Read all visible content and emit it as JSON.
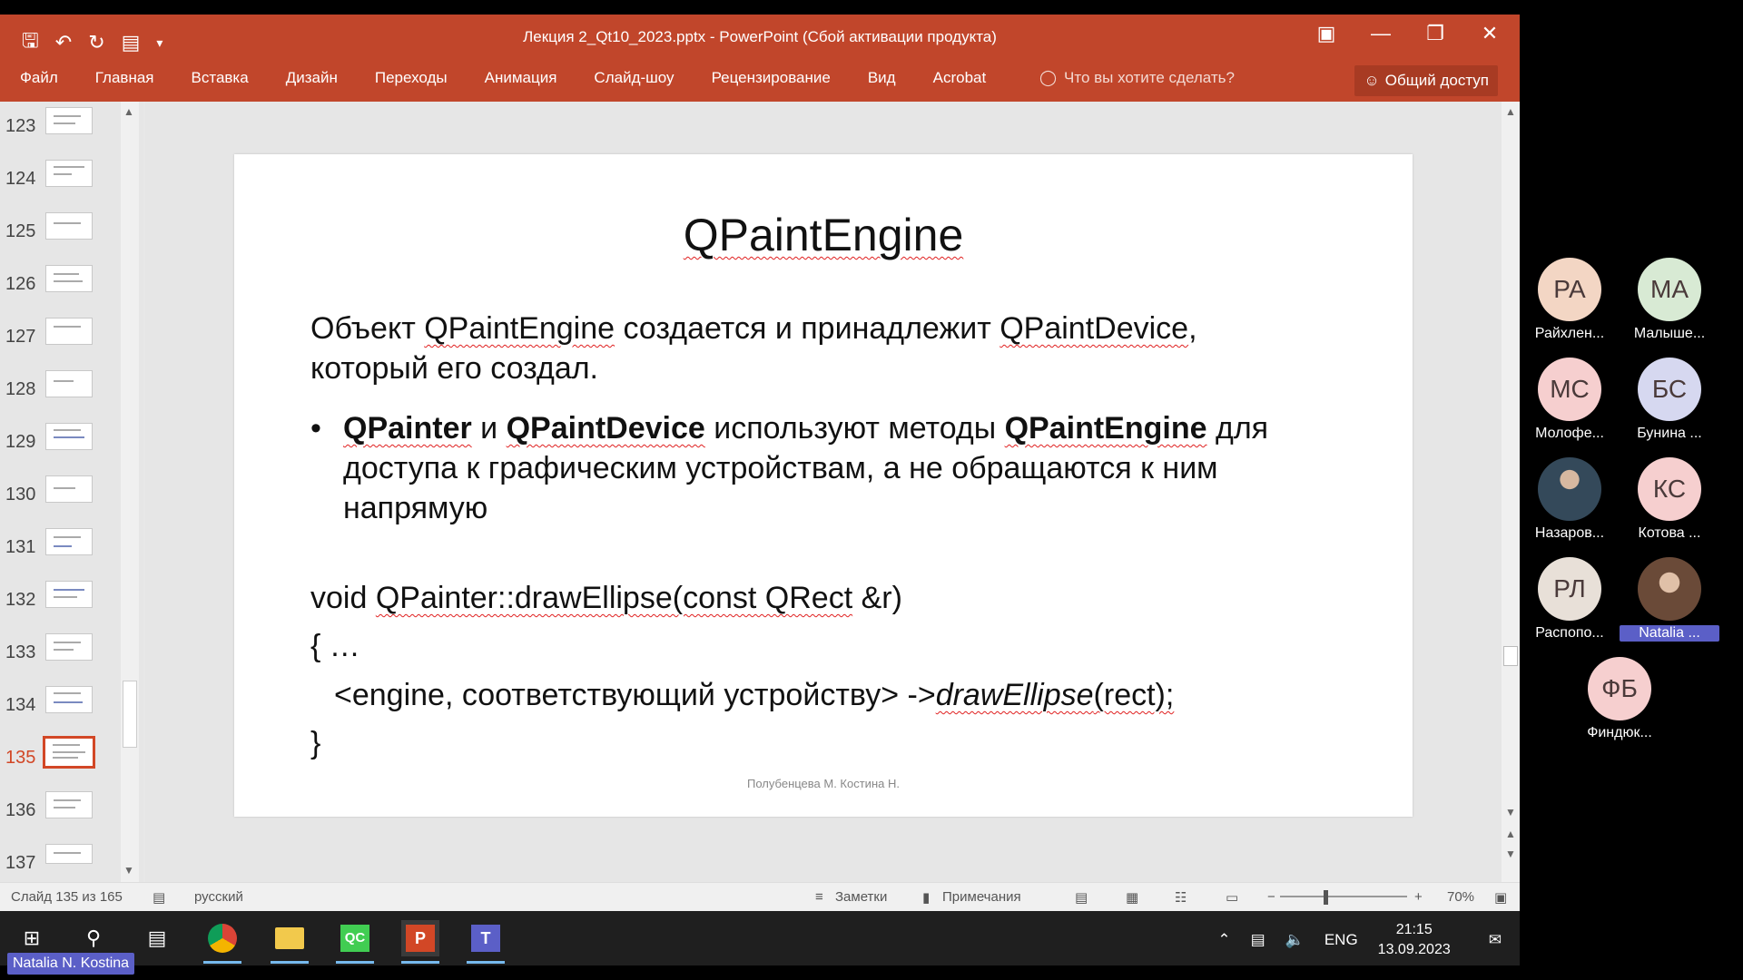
{
  "window": {
    "title": "Лекция 2_Qt10_2023.pptx - PowerPoint (Сбой активации продукта)",
    "colors": {
      "accent": "#c1462b",
      "accent_dark": "#a83b23",
      "active_thumb": "#d24726"
    }
  },
  "menu": {
    "tabs": [
      "Файл",
      "Главная",
      "Вставка",
      "Дизайн",
      "Переходы",
      "Анимация",
      "Слайд-шоу",
      "Рецензирование",
      "Вид",
      "Acrobat"
    ],
    "tell_me": "Что вы хотите сделать?",
    "share": "Общий доступ"
  },
  "thumbnails": [
    {
      "num": "123"
    },
    {
      "num": "124"
    },
    {
      "num": "125"
    },
    {
      "num": "126"
    },
    {
      "num": "127"
    },
    {
      "num": "128"
    },
    {
      "num": "129"
    },
    {
      "num": "130"
    },
    {
      "num": "131"
    },
    {
      "num": "132"
    },
    {
      "num": "133"
    },
    {
      "num": "134"
    },
    {
      "num": "135",
      "active": true
    },
    {
      "num": "136"
    },
    {
      "num": "137"
    }
  ],
  "slide": {
    "title": "QPaintEngine",
    "p1_a": "Объект ",
    "p1_b": "QPaintEngine",
    "p1_c": " создается и принадлежит ",
    "p1_d": "QPaintDevice",
    "p1_e": ",",
    "p1_line2": "который его создал.",
    "bullet_dot": "•",
    "b_1": "QPainter",
    "b_2": "  и ",
    "b_3": "QPaintDevice",
    "b_4": " используют методы ",
    "b_5": "QPaintEngine",
    "b_6": " для доступа к графическим устройствам, а не обращаются  к ним напрямую",
    "code1_a": "void ",
    "code1_b": "QPainter::drawEllipse(const QRect",
    "code1_c": " &r)",
    "code2": "{  …",
    "code3_a": "<engine, соответствующий устройству> ->",
    "code3_b": "drawEllipse",
    "code3_c": "(rect);",
    "code4": "}",
    "footer": "Полубенцева М. Костина Н."
  },
  "status": {
    "slide_info": "Слайд 135 из 165",
    "language": "русский",
    "notes": "Заметки",
    "comments": "Примечания",
    "zoom": "70%"
  },
  "taskbar": {
    "lang": "ENG",
    "time": "21:15",
    "date": "13.09.2023",
    "presenter_badge": "Natalia N. Kostina"
  },
  "participants": [
    {
      "initials": "РА",
      "name": "Райхлен...",
      "color": "#f3d6c4"
    },
    {
      "initials": "МА",
      "name": "Малыше...",
      "color": "#d8ead4"
    },
    {
      "initials": "МС",
      "name": "Молофе...",
      "color": "#f6cfcf"
    },
    {
      "initials": "БС",
      "name": "Бунина ...",
      "color": "#d6d8f0"
    },
    {
      "initials": "",
      "name": "Назаров...",
      "color": "#3b5a6a",
      "photo": true
    },
    {
      "initials": "КС",
      "name": "Котова ...",
      "color": "#f6cfcf"
    },
    {
      "initials": "РЛ",
      "name": "Распопо...",
      "color": "#e8e0d8"
    },
    {
      "initials": "",
      "name": "Natalia ...",
      "color": "#7a5a48",
      "photo": true,
      "highlight": true
    },
    {
      "initials": "ФБ",
      "name": "Финдюк...",
      "color": "#f6cfcf"
    }
  ]
}
